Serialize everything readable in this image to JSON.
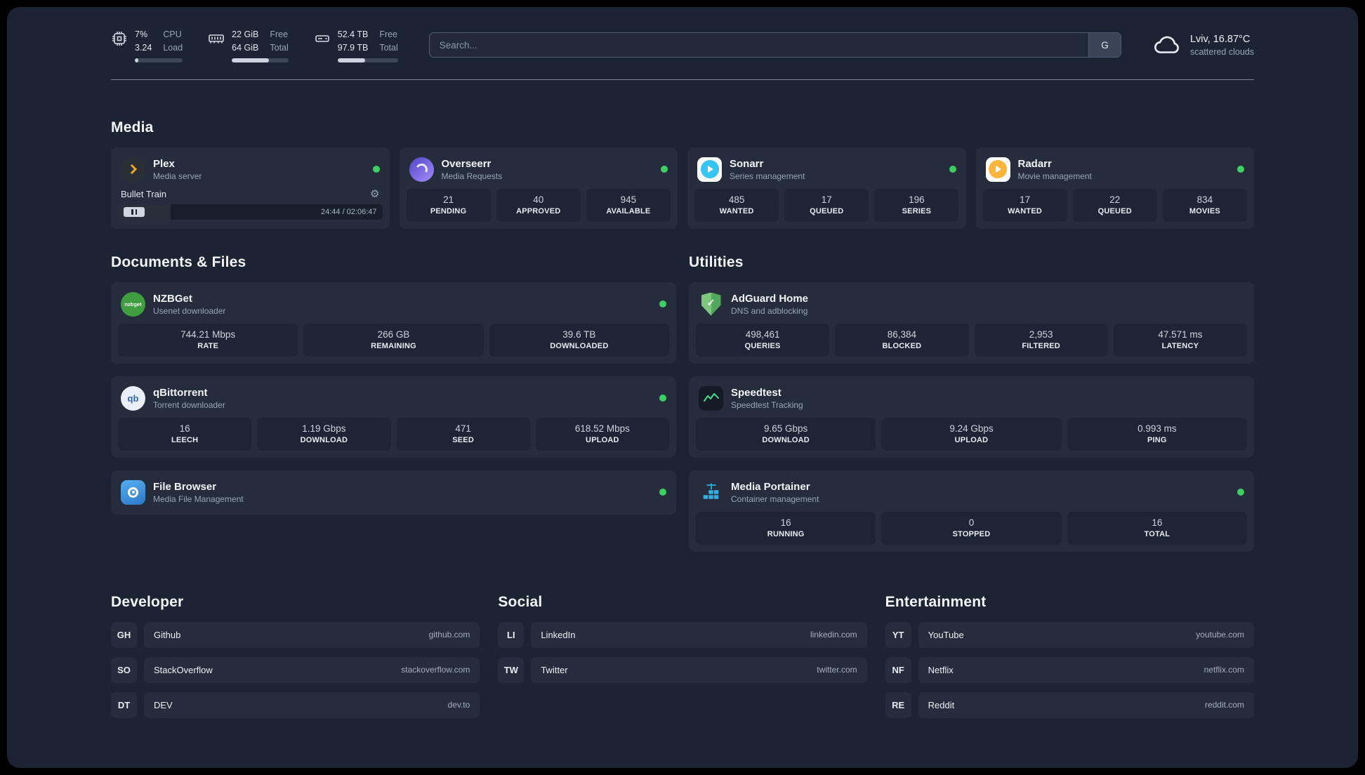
{
  "colors": {
    "status_online": "#3ecf63",
    "plex_gold": "#e8a426",
    "sonarr_blue": "#35c5f4",
    "radarr_gold": "#ffb53c",
    "nzbget_green": "#3f9e3f",
    "qbittorrent_blue": "#2f67ba",
    "speedtest_green": "#3ddc84",
    "portainer_blue": "#2fb1e3"
  },
  "topbar": {
    "cpu": {
      "value_top": "7%",
      "value_bottom": "3.24",
      "label_top": "CPU",
      "label_bottom": "Load",
      "bar": 7
    },
    "ram": {
      "value_top": "22 GiB",
      "value_bottom": "64 GiB",
      "label_top": "Free",
      "label_bottom": "Total",
      "bar": 66
    },
    "disk": {
      "value_top": "52.4 TB",
      "value_bottom": "97.9 TB",
      "label_top": "Free",
      "label_bottom": "Total",
      "bar": 46
    },
    "search": {
      "placeholder": "Search...",
      "provider": "G"
    },
    "weather": {
      "location": "Lviv, 16.87°C",
      "description": "scattered clouds"
    }
  },
  "sections": {
    "media": "Media",
    "documents": "Documents & Files",
    "utilities": "Utilities",
    "developer": "Developer",
    "social": "Social",
    "entertainment": "Entertainment"
  },
  "icons": {
    "nzbget_text": "nzbget",
    "qbittorrent_text": "qb",
    "adguard_check": "✓",
    "gear": "⚙"
  },
  "services": {
    "plex": {
      "name": "Plex",
      "subtitle": "Media server",
      "player": {
        "track": "Bullet Train",
        "time": "24:44 / 02:06:47",
        "progress": 20
      }
    },
    "overseerr": {
      "name": "Overseerr",
      "subtitle": "Media Requests",
      "stats": [
        {
          "value": "21",
          "label": "PENDING"
        },
        {
          "value": "40",
          "label": "APPROVED"
        },
        {
          "value": "945",
          "label": "AVAILABLE"
        }
      ]
    },
    "sonarr": {
      "name": "Sonarr",
      "subtitle": "Series management",
      "stats": [
        {
          "value": "485",
          "label": "WANTED"
        },
        {
          "value": "17",
          "label": "QUEUED"
        },
        {
          "value": "196",
          "label": "SERIES"
        }
      ]
    },
    "radarr": {
      "name": "Radarr",
      "subtitle": "Movie management",
      "stats": [
        {
          "value": "17",
          "label": "WANTED"
        },
        {
          "value": "22",
          "label": "QUEUED"
        },
        {
          "value": "834",
          "label": "MOVIES"
        }
      ]
    },
    "nzbget": {
      "name": "NZBGet",
      "subtitle": "Usenet downloader",
      "stats": [
        {
          "value": "744.21 Mbps",
          "label": "RATE"
        },
        {
          "value": "266 GB",
          "label": "REMAINING"
        },
        {
          "value": "39.6 TB",
          "label": "DOWNLOADED"
        }
      ]
    },
    "qbittorrent": {
      "name": "qBittorrent",
      "subtitle": "Torrent downloader",
      "stats": [
        {
          "value": "16",
          "label": "LEECH"
        },
        {
          "value": "1.19 Gbps",
          "label": "DOWNLOAD"
        },
        {
          "value": "471",
          "label": "SEED"
        },
        {
          "value": "618.52 Mbps",
          "label": "UPLOAD"
        }
      ]
    },
    "filebrowser": {
      "name": "File Browser",
      "subtitle": "Media File Management"
    },
    "adguard": {
      "name": "AdGuard Home",
      "subtitle": "DNS and adblocking",
      "stats": [
        {
          "value": "498,461",
          "label": "QUERIES"
        },
        {
          "value": "86,384",
          "label": "BLOCKED"
        },
        {
          "value": "2,953",
          "label": "FILTERED"
        },
        {
          "value": "47.571 ms",
          "label": "LATENCY"
        }
      ]
    },
    "speedtest": {
      "name": "Speedtest",
      "subtitle": "Speedtest Tracking",
      "stats": [
        {
          "value": "9.65 Gbps",
          "label": "DOWNLOAD"
        },
        {
          "value": "9.24 Gbps",
          "label": "UPLOAD"
        },
        {
          "value": "0.993 ms",
          "label": "PING"
        }
      ]
    },
    "portainer": {
      "name": "Media Portainer",
      "subtitle": "Container management",
      "stats": [
        {
          "value": "16",
          "label": "RUNNING"
        },
        {
          "value": "0",
          "label": "STOPPED"
        },
        {
          "value": "16",
          "label": "TOTAL"
        }
      ]
    }
  },
  "bookmarks": {
    "developer": [
      {
        "abbr": "GH",
        "name": "Github",
        "domain": "github.com"
      },
      {
        "abbr": "SO",
        "name": "StackOverflow",
        "domain": "stackoverflow.com"
      },
      {
        "abbr": "DT",
        "name": "DEV",
        "domain": "dev.to"
      }
    ],
    "social": [
      {
        "abbr": "LI",
        "name": "LinkedIn",
        "domain": "linkedin.com"
      },
      {
        "abbr": "TW",
        "name": "Twitter",
        "domain": "twitter.com"
      }
    ],
    "entertainment": [
      {
        "abbr": "YT",
        "name": "YouTube",
        "domain": "youtube.com"
      },
      {
        "abbr": "NF",
        "name": "Netflix",
        "domain": "netflix.com"
      },
      {
        "abbr": "RE",
        "name": "Reddit",
        "domain": "reddit.com"
      }
    ]
  }
}
